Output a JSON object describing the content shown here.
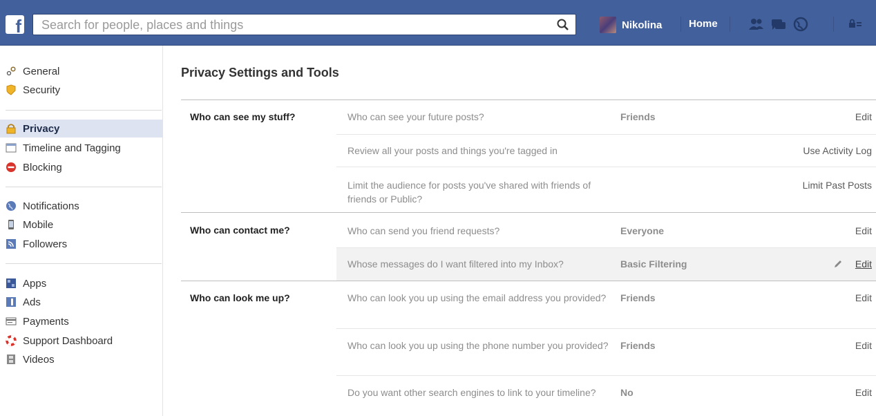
{
  "topbar": {
    "search_placeholder": "Search for people, places and things",
    "user_name": "Nikolina",
    "home_label": "Home"
  },
  "sidebar": {
    "items": [
      {
        "label": "General",
        "icon": "gears-icon"
      },
      {
        "label": "Security",
        "icon": "shield-badge-icon"
      },
      {
        "label": "Privacy",
        "icon": "padlock-icon",
        "active": true
      },
      {
        "label": "Timeline and Tagging",
        "icon": "timeline-icon"
      },
      {
        "label": "Blocking",
        "icon": "blocking-icon"
      },
      {
        "label": "Notifications",
        "icon": "globe-icon"
      },
      {
        "label": "Mobile",
        "icon": "mobile-phone-icon"
      },
      {
        "label": "Followers",
        "icon": "rss-icon"
      },
      {
        "label": "Apps",
        "icon": "apps-icon"
      },
      {
        "label": "Ads",
        "icon": "ads-icon"
      },
      {
        "label": "Payments",
        "icon": "payments-icon"
      },
      {
        "label": "Support Dashboard",
        "icon": "lifebuoy-icon"
      },
      {
        "label": "Videos",
        "icon": "film-icon"
      }
    ]
  },
  "main": {
    "title": "Privacy Settings and Tools",
    "sections": [
      {
        "label": "Who can see my stuff?",
        "rows": [
          {
            "question": "Who can see your future posts?",
            "value": "Friends",
            "action": "Edit"
          },
          {
            "question": "Review all your posts and things you're tagged in",
            "value": "",
            "action": "Use Activity Log"
          },
          {
            "question": "Limit the audience for posts you've shared with friends of friends or Public?",
            "value": "",
            "action": "Limit Past Posts"
          }
        ]
      },
      {
        "label": "Who can contact me?",
        "rows": [
          {
            "question": "Who can send you friend requests?",
            "value": "Everyone",
            "action": "Edit"
          },
          {
            "question": "Whose messages do I want filtered into my Inbox?",
            "value": "Basic Filtering",
            "action": "Edit"
          }
        ]
      },
      {
        "label": "Who can look me up?",
        "rows": [
          {
            "question": "Who can look you up using the email address you provided?",
            "value": "Friends",
            "action": "Edit"
          },
          {
            "question": "Who can look you up using the phone number you provided?",
            "value": "Friends",
            "action": "Edit"
          },
          {
            "question": "Do you want other search engines to link to your timeline?",
            "value": "No",
            "action": "Edit"
          }
        ]
      }
    ]
  },
  "colors": {
    "topbar": "#42609c",
    "active_nav": "#dde3f0"
  }
}
